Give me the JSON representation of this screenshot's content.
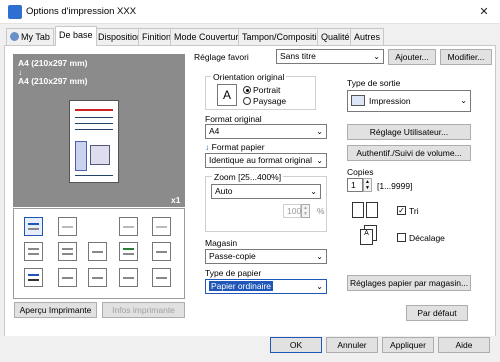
{
  "window": {
    "title": "Options d'impression XXX",
    "close_glyph": "✕"
  },
  "tabs": [
    "My Tab",
    "De base",
    "Disposition",
    "Finition",
    "Mode Couverture",
    "Tampon/Composition",
    "Qualité",
    "Autres"
  ],
  "active_tab": "De base",
  "preview": {
    "line1": "A4 (210x297 mm)",
    "line2": "A4 (210x297 mm)",
    "copies_badge": "x1"
  },
  "left_buttons": {
    "preview": "Aperçu Imprimante",
    "printer_info": "Infos imprimante"
  },
  "favorite": {
    "label": "Réglage favori",
    "value": "Sans titre",
    "add": "Ajouter...",
    "modify": "Modifier..."
  },
  "orientation": {
    "label": "Orientation original",
    "portrait": "Portrait",
    "landscape": "Paysage",
    "selected": "Portrait",
    "icon_letter": "A"
  },
  "original_size": {
    "label": "Format original",
    "value": "A4"
  },
  "paper_size": {
    "label": "Format papier",
    "value": "Identique au format original"
  },
  "zoom": {
    "label": "Zoom [25...400%]",
    "value": "Auto",
    "percent_value": "100",
    "percent_unit": "%"
  },
  "tray": {
    "label": "Magasin",
    "value": "Passe-copie"
  },
  "paper_type": {
    "label": "Type de papier",
    "value": "Papier ordinaire"
  },
  "output_type": {
    "label": "Type de sortie",
    "value": "Impression"
  },
  "user_settings_btn": "Réglage Utilisateur...",
  "auth_btn": "Authentif./Suivi de volume...",
  "copies": {
    "label": "Copies",
    "value": "1",
    "range": "[1...9999]"
  },
  "collate": {
    "label": "Tri",
    "checked": true,
    "check_glyph": "✓"
  },
  "offset": {
    "label": "Décalage",
    "checked": false
  },
  "paper_tray_settings_btn": "Réglages papier par magasin...",
  "default_btn": "Par défaut",
  "dialog_buttons": {
    "ok": "OK",
    "cancel": "Annuler",
    "apply": "Appliquer",
    "help": "Aide"
  },
  "colors": {
    "accent": "#1f56b8",
    "preview_bg": "#8b8b8b"
  }
}
